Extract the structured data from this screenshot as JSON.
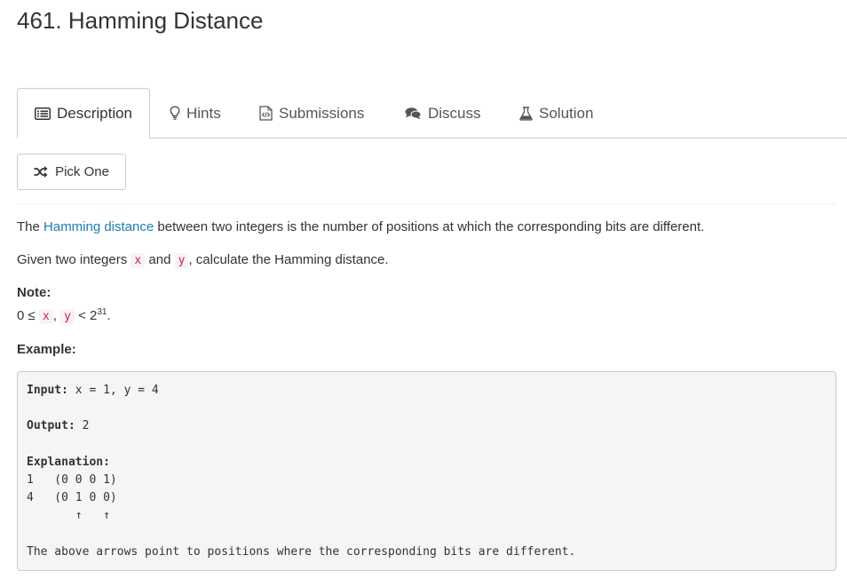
{
  "problem": {
    "title": "461. Hamming Distance"
  },
  "tabs": [
    {
      "label": "Description",
      "icon": "description-icon"
    },
    {
      "label": "Hints",
      "icon": "lightbulb-icon"
    },
    {
      "label": "Submissions",
      "icon": "code-file-icon"
    },
    {
      "label": "Discuss",
      "icon": "comments-icon"
    },
    {
      "label": "Solution",
      "icon": "flask-icon"
    }
  ],
  "pick_one": {
    "label": "Pick One",
    "icon": "shuffle-icon"
  },
  "description": {
    "p1": {
      "pre": "The ",
      "link": "Hamming distance",
      "post": " between two integers is the number of positions at which the corresponding bits are different."
    },
    "p2": {
      "pre": "Given two integers ",
      "x": "x",
      "mid": " and ",
      "y": "y",
      "post": ", calculate the Hamming distance."
    },
    "note": {
      "label": "Note:",
      "zero_le": "0 ≤ ",
      "x": "x",
      "comma": ", ",
      "y": "y",
      "lt": " < 2",
      "exp": "31",
      "end": "."
    },
    "example_label": "Example:"
  },
  "example": {
    "input_label": "Input:",
    "input_value": " x = 1, y = 4",
    "output_label": "Output:",
    "output_value": " 2",
    "explanation_label": "Explanation:",
    "line1": "1   (0 0 0 1)",
    "line2": "4   (0 1 0 0)",
    "arrows": "       ↑   ↑",
    "footer": "The above arrows point to positions where the corresponding bits are different."
  },
  "colors": {
    "link": "#1a7fb5",
    "inline_code": "#c7254e",
    "inline_code_bg": "#f9f2f4",
    "code_block_bg": "#f5f5f5",
    "border": "#cccccc"
  }
}
